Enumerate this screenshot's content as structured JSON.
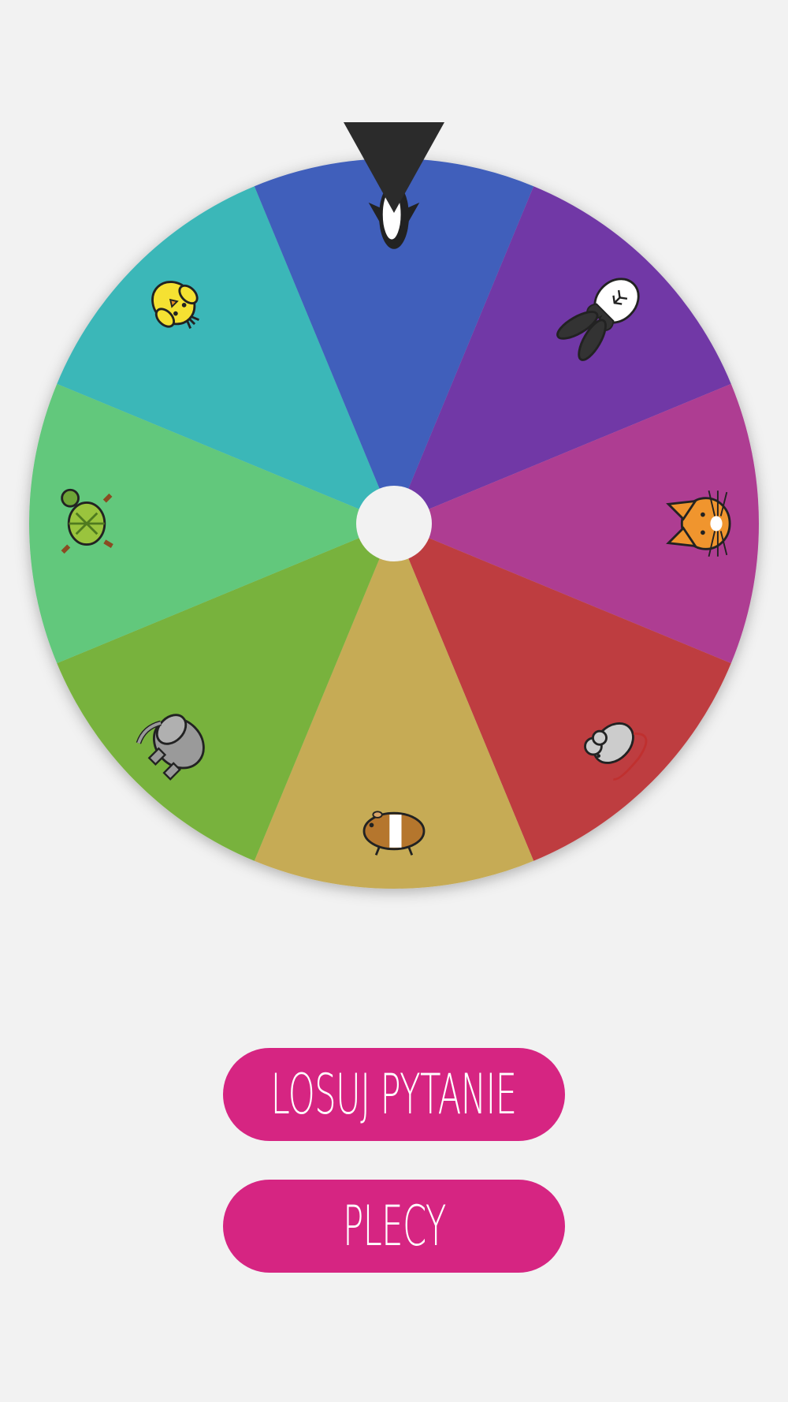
{
  "wheel": {
    "segments": [
      {
        "color": "#3bb7b8",
        "animal": "chick-icon"
      },
      {
        "color": "#3f5fbb",
        "animal": "penguin-icon"
      },
      {
        "color": "#7139a6",
        "animal": "rabbit-icon"
      },
      {
        "color": "#ae3c92",
        "animal": "cat-icon"
      },
      {
        "color": "#be3e41",
        "animal": "mouse-icon"
      },
      {
        "color": "#c6ab55",
        "animal": "guinea-pig-icon"
      },
      {
        "color": "#78b23d",
        "animal": "elephant-icon"
      },
      {
        "color": "#62c87b",
        "animal": "turtle-icon"
      }
    ],
    "pointer_color": "#2b2b2b",
    "hub_color": "#f2f2f2"
  },
  "buttons": {
    "draw_label": "LOSUJ PYTANIE",
    "back_label": "PLECY",
    "color": "#d62582"
  }
}
